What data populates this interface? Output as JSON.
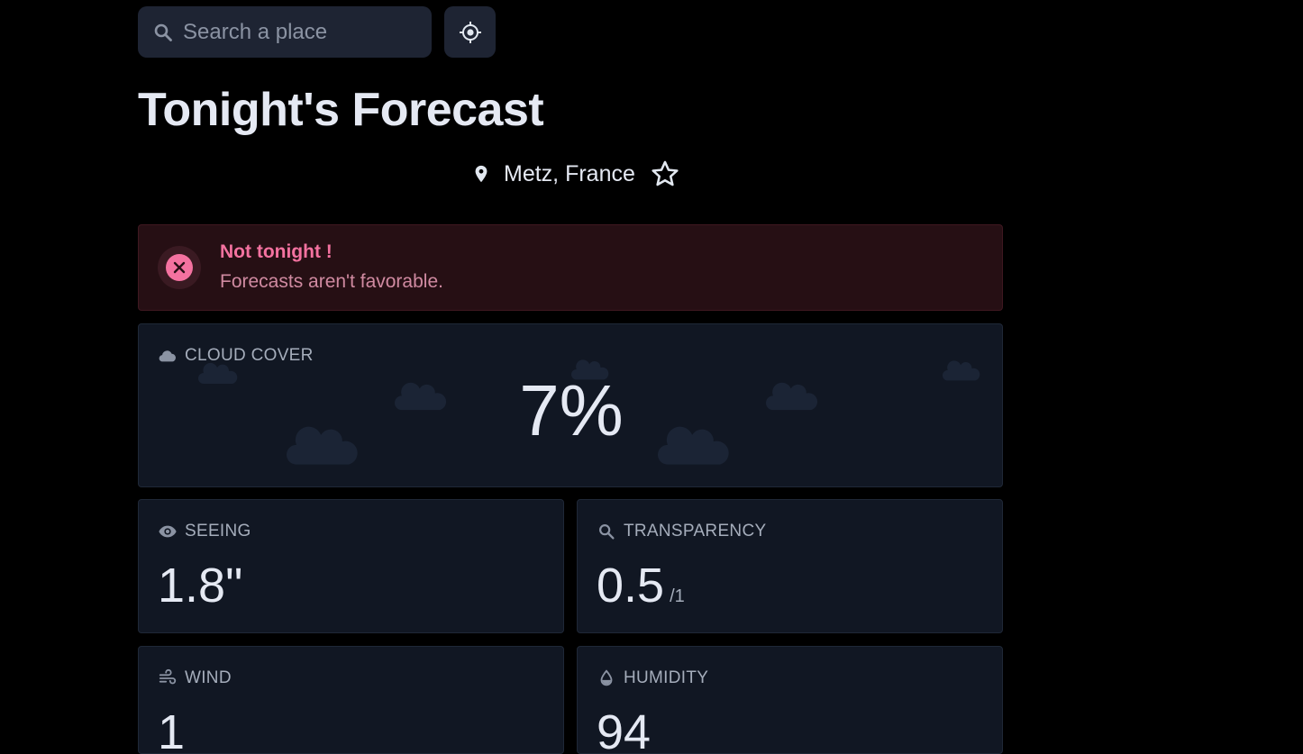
{
  "search": {
    "placeholder": "Search a place",
    "icon": "search-icon"
  },
  "locate_button": {
    "icon": "crosshair-icon"
  },
  "title": "Tonight's Forecast",
  "location": {
    "name": "Metz, France",
    "pin_icon": "map-pin-icon",
    "favorite_icon": "star-outline-icon"
  },
  "alert": {
    "title": "Not tonight !",
    "text": "Forecasts aren't favorable.",
    "icon": "close-circle-icon",
    "color": "#f472a0"
  },
  "metrics": {
    "cloud_cover": {
      "label": "CLOUD COVER",
      "value": "7%",
      "icon": "cloud-icon"
    },
    "seeing": {
      "label": "SEEING",
      "value": "1.8\"",
      "icon": "eye-icon"
    },
    "transparency": {
      "label": "TRANSPARENCY",
      "value": "0.5",
      "unit": "/1",
      "icon": "magnifier-icon"
    },
    "wind": {
      "label": "WIND",
      "value": "1",
      "icon": "wind-icon"
    },
    "humidity": {
      "label": "HUMIDITY",
      "value": "94",
      "icon": "droplet-icon"
    }
  },
  "colors": {
    "background": "#000000",
    "card": "#111723",
    "alert_bg": "#260f14",
    "accent_pink": "#f472a0"
  }
}
